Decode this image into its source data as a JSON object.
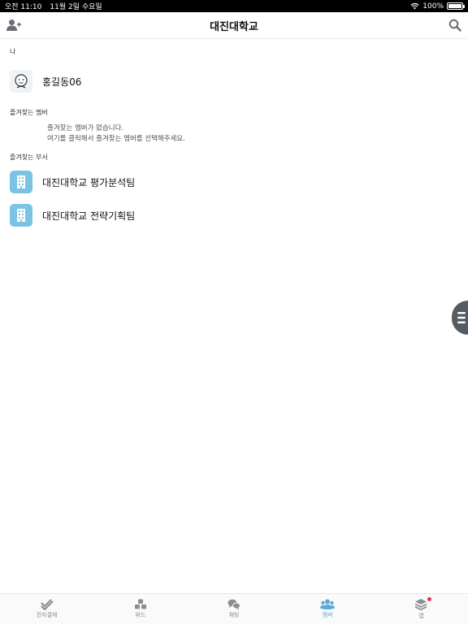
{
  "status_bar": {
    "time": "오전 11:10",
    "date": "11월 2일 수요일",
    "battery": "100%",
    "battery_level": 1.0
  },
  "header": {
    "title": "대진대학교"
  },
  "me": {
    "section_label": "나",
    "name": "홍길동06"
  },
  "favorite_members": {
    "section_label": "즐겨찾는 멤버",
    "empty_line1": "즐겨찾는 멤버가 없습니다.",
    "empty_line2": "여기를 클릭해서 즐겨찾는 멤버를 선택해주세요."
  },
  "favorite_departments": {
    "section_label": "즐겨찾는 부서",
    "items": [
      {
        "label": "대진대학교 평가분석팀",
        "icon": "building-icon"
      },
      {
        "label": "대진대학교 전략기획팀",
        "icon": "building-icon"
      }
    ]
  },
  "tabs": [
    {
      "label": "전자결재",
      "icon": "approval-check-icon",
      "active": false
    },
    {
      "label": "위드",
      "icon": "cubes-icon",
      "active": false
    },
    {
      "label": "채팅",
      "icon": "chat-bubbles-icon",
      "active": false
    },
    {
      "label": "멤버",
      "icon": "members-icon",
      "active": true
    },
    {
      "label": "앱",
      "icon": "layers-icon",
      "active": false,
      "badge": true
    }
  ],
  "colors": {
    "accent": "#5aa9d6",
    "dept_icon": "#7cc3e3",
    "badge": "#e4335a",
    "handle": "#555b63"
  }
}
